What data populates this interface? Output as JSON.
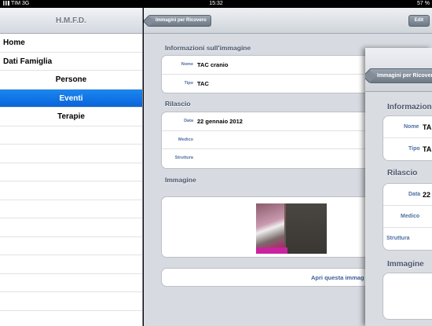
{
  "statusbar": {
    "carrier": "TIM 3G",
    "time": "15:32",
    "battery": "57 %"
  },
  "master": {
    "title": "H.M.F.D.",
    "items": [
      {
        "label": "Home"
      },
      {
        "label": "Dati Famiglia"
      },
      {
        "label": "Persone"
      },
      {
        "label": "Eventi"
      },
      {
        "label": "Terapie"
      }
    ]
  },
  "detail": {
    "back_label": "Immagini per Ricovero",
    "edit_label": "Edit",
    "info_title": "Informazioni sull'immagine",
    "info_rows": [
      {
        "label": "Nome",
        "value": "TAC cranio"
      },
      {
        "label": "Tipo",
        "value": "TAC"
      }
    ],
    "release_title": "Rilascio",
    "release_rows": [
      {
        "label": "Data",
        "value": "22 gennaio 2012"
      },
      {
        "label": "Medico",
        "value": ""
      },
      {
        "label": "Struttura",
        "value": ""
      }
    ],
    "image_title": "Immagine",
    "open_label": "Apri questa immag"
  },
  "overlay": {
    "back_label": "Immagini per Ricovero",
    "info_title": "Informazion",
    "info_rows": [
      {
        "label": "Nome",
        "value": "TA"
      },
      {
        "label": "Tipo",
        "value": "TA"
      }
    ],
    "release_title": "Rilascio",
    "release_rows": [
      {
        "label": "Data",
        "value": "22"
      },
      {
        "label": "Medico",
        "value": ""
      },
      {
        "label": "Struttura",
        "value": ""
      }
    ],
    "image_title": "Immagine"
  }
}
